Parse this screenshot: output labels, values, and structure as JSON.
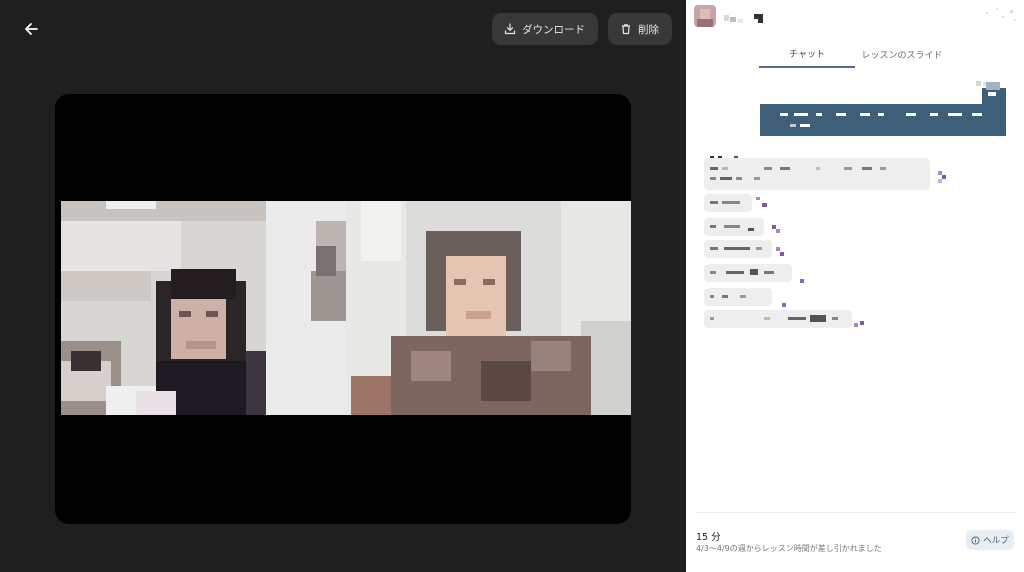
{
  "toolbar": {
    "back_icon": "arrow-left-icon",
    "download_label": "ダウンロード",
    "download_icon": "download-icon",
    "delete_label": "削除",
    "delete_icon": "trash-icon"
  },
  "panel": {
    "tabs": [
      {
        "label": "チャット",
        "active": true
      },
      {
        "label": "レッスンのスライド",
        "active": false
      }
    ]
  },
  "footer": {
    "duration": "15 分",
    "note": "4/3〜4/9の週からレッスン時間が差し引かれました",
    "help_label": "ヘルプ",
    "help_icon": "info-circle-icon"
  },
  "colors": {
    "player_bg": "#1f1f1f",
    "button_bg": "#383838",
    "accent": "#3e5f7a",
    "tab_active": "#3a4a70"
  }
}
